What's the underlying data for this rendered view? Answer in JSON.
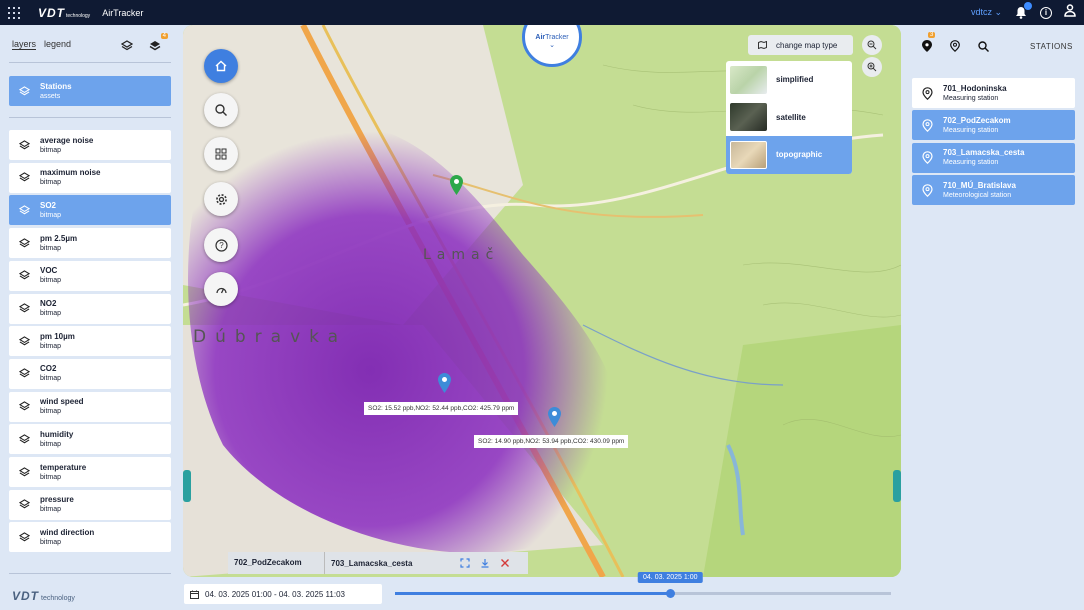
{
  "app": {
    "brand": "VDT",
    "brand_sub": "technology",
    "name": "AirTracker",
    "user": "vdtcz",
    "accent": "#3f7fe0",
    "topbar_color": "#0f1a33"
  },
  "left_panel": {
    "tabs": [
      "layers",
      "legend"
    ],
    "active_tab": "layers",
    "layers_count": "4",
    "assets": {
      "label": "Stations",
      "sub": "assets"
    },
    "items": [
      {
        "label": "average noise",
        "sub": "bitmap"
      },
      {
        "label": "maximum noise",
        "sub": "bitmap"
      },
      {
        "label": "SO2",
        "sub": "bitmap",
        "selected": true
      },
      {
        "label": "pm 2.5µm",
        "sub": "bitmap"
      },
      {
        "label": "VOC",
        "sub": "bitmap"
      },
      {
        "label": "NO2",
        "sub": "bitmap"
      },
      {
        "label": "pm 10µm",
        "sub": "bitmap"
      },
      {
        "label": "CO2",
        "sub": "bitmap"
      },
      {
        "label": "wind speed",
        "sub": "bitmap"
      },
      {
        "label": "humidity",
        "sub": "bitmap"
      },
      {
        "label": "temperature",
        "sub": "bitmap"
      },
      {
        "label": "pressure",
        "sub": "bitmap"
      },
      {
        "label": "wind direction",
        "sub": "bitmap"
      }
    ],
    "footer_brand": "VDT",
    "footer_sub": "technology"
  },
  "map": {
    "airtracker_air": "Air",
    "airtracker_rest": "Tracker",
    "change_map_type": "change map type",
    "map_types": [
      {
        "label": "simplified"
      },
      {
        "label": "satellite"
      },
      {
        "label": "topographic",
        "selected": true
      }
    ],
    "place_labels": [
      "Lamač",
      "Dúbravka"
    ],
    "tooltips": [
      "SO2: 15.52 ppb,NO2: 52.44 ppb,CO2: 425.79 ppm",
      "SO2: 14.90 ppb,NO2: 53.94 ppb,CO2: 430.09 ppm"
    ],
    "bottom_labels": [
      "702_PodZecakom",
      "703_Lamacska_cesta"
    ]
  },
  "right_panel": {
    "title": "STATIONS",
    "marker_count": "3",
    "stations": [
      {
        "name": "701_Hodoninska",
        "type": "Measuring station"
      },
      {
        "name": "702_PodZecakom",
        "type": "Measuring station",
        "selected": true
      },
      {
        "name": "703_Lamacska_cesta",
        "type": "Measuring station",
        "selected": true
      },
      {
        "name": "710_MÚ_Bratislava",
        "type": "Meteorological station",
        "selected": true
      }
    ]
  },
  "timeline": {
    "date_range": "04. 03. 2025 01:00 - 04. 03. 2025 11:03",
    "current": "04. 03. 2025 1:00",
    "progress": 0.555
  }
}
